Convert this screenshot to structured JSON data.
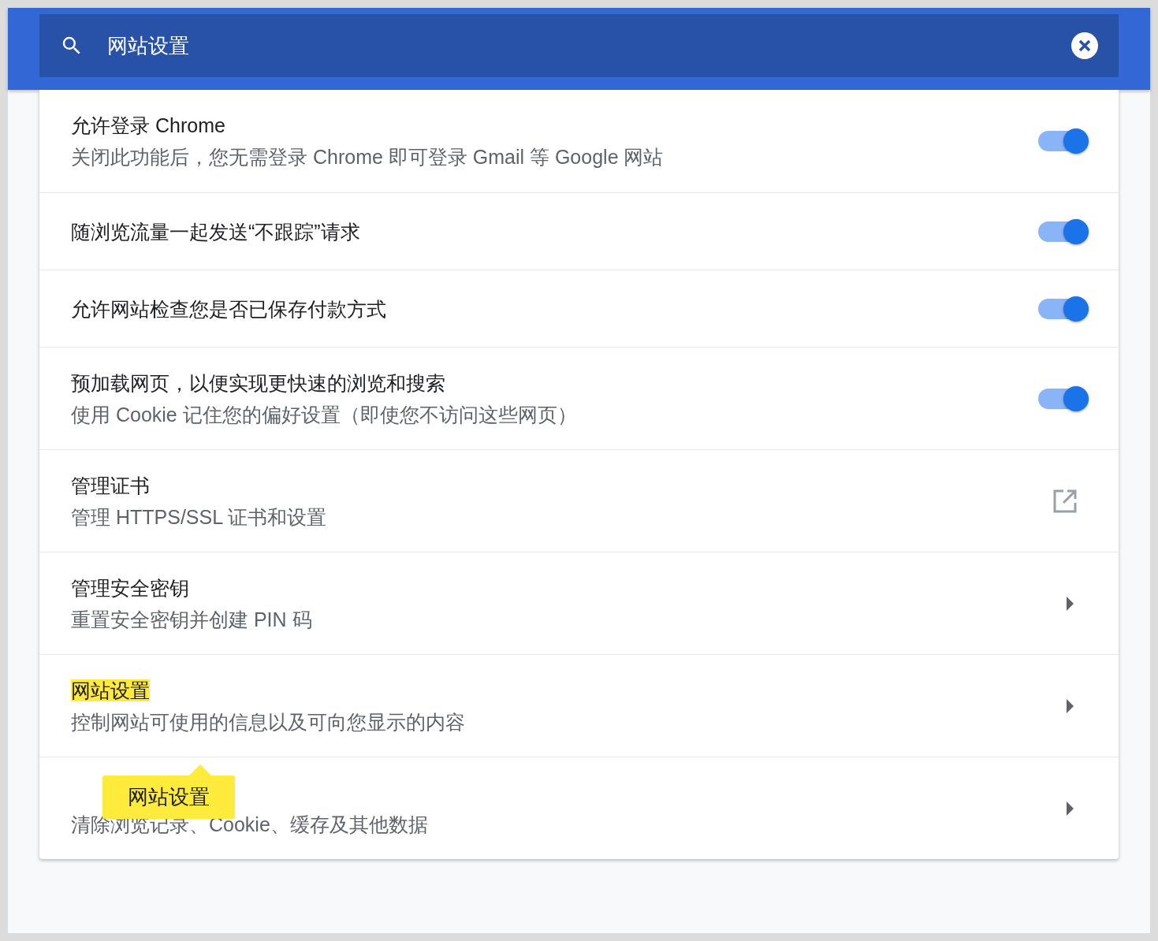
{
  "search": {
    "value": "网站设置"
  },
  "rows": [
    {
      "kind": "toggle",
      "title": "允许登录 Chrome",
      "title_highlighted": false,
      "subtitle": "关闭此功能后，您无需登录 Chrome 即可登录 Gmail 等 Google 网站",
      "on": true
    },
    {
      "kind": "toggle",
      "title": "随浏览流量一起发送“不跟踪”请求",
      "title_highlighted": false,
      "on": true
    },
    {
      "kind": "toggle",
      "title": "允许网站检查您是否已保存付款方式",
      "title_highlighted": false,
      "on": true
    },
    {
      "kind": "toggle",
      "title": "预加载网页，以便实现更快速的浏览和搜索",
      "title_highlighted": false,
      "subtitle": "使用 Cookie 记住您的偏好设置（即使您不访问这些网页）",
      "on": true
    },
    {
      "kind": "external",
      "title": "管理证书",
      "title_highlighted": false,
      "subtitle": "管理 HTTPS/SSL 证书和设置"
    },
    {
      "kind": "arrow",
      "title": "管理安全密钥",
      "title_highlighted": false,
      "subtitle": "重置安全密钥并创建 PIN 码"
    },
    {
      "kind": "arrow",
      "title": "网站设置",
      "title_highlighted": true,
      "subtitle": "控制网站可使用的信息以及可向您显示的内容"
    },
    {
      "kind": "arrow",
      "subtitle": "清除浏览记录、Cookie、缓存及其他数据",
      "tooltip": "网站设置"
    }
  ]
}
